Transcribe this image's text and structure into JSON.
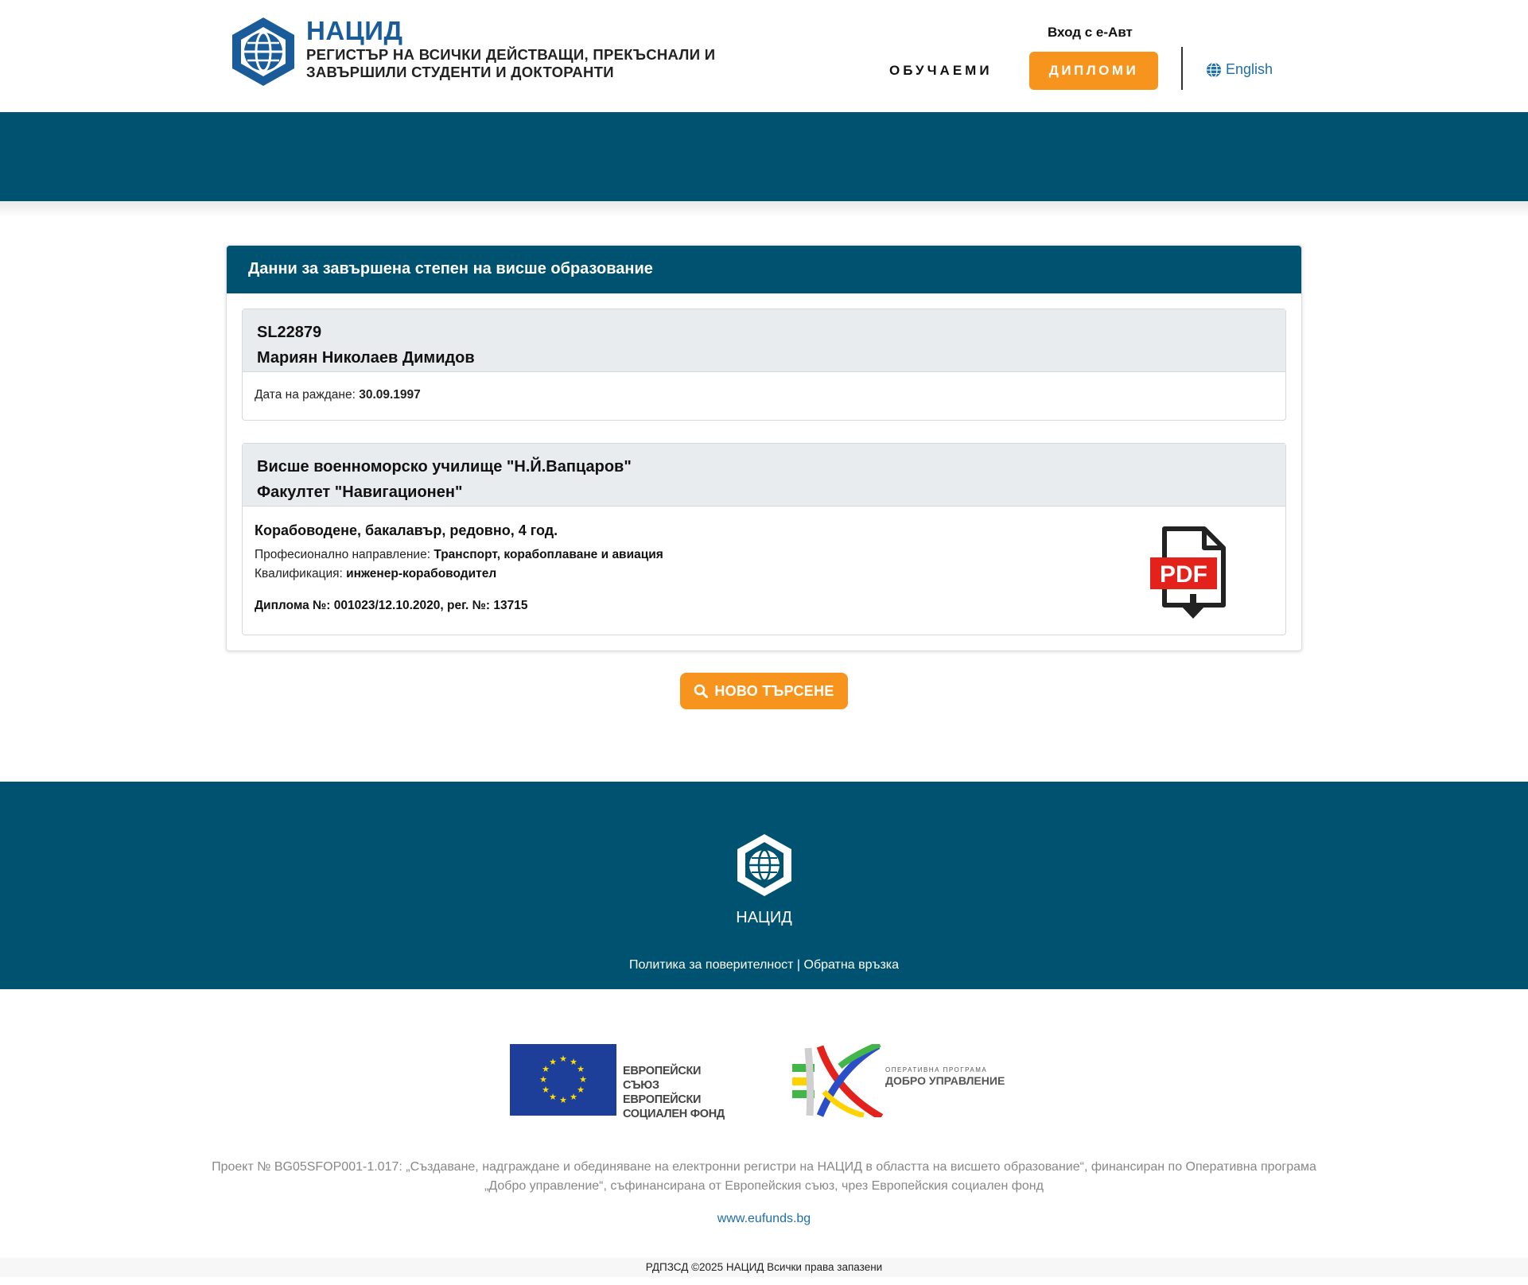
{
  "header": {
    "brand_name": "НАЦИД",
    "brand_subtitle": "РЕГИСТЪР НА ВСИЧКИ ДЕЙСТВАЩИ, ПРЕКЪСНАЛИ И ЗАВЪРШИЛИ СТУДЕНТИ И ДОКТОРАНТИ",
    "eauth_label": "Вход с е-Авт",
    "nav_students": "ОБУЧАЕМИ",
    "nav_diplomas": "ДИПЛОМИ",
    "language_label": "English"
  },
  "card": {
    "title": "Данни за завършена степен на висше образование",
    "person": {
      "id": "SL22879",
      "name": "Мариян Николаев Димидов",
      "birth_label": "Дата на раждане:",
      "birth_date": "30.09.1997"
    },
    "education": {
      "institution": "Висше военноморско училище \"Н.Й.Вапцаров\"",
      "faculty": "Факултет \"Навигационен\"",
      "specialty": "Корабоводене, бакалавър, редовно, 4 год.",
      "field_label": "Професионално направление:",
      "field_value": "Транспорт, корабоплаване и авиация",
      "qualification_label": "Квалификация:",
      "qualification_value": "инженер-корабоводител",
      "diploma": "Диплома №: 001023/12.10.2020, рег. №: 13715",
      "pdf_label": "PDF"
    }
  },
  "new_search_label": "НОВО ТЪРСЕНЕ",
  "footer": {
    "name": "НАЦИД",
    "privacy_link": "Политика за поверителност",
    "separator": "|",
    "feedback_link": "Обратна връзка"
  },
  "sponsors": {
    "eu_text": [
      "ЕВРОПЕЙСКИ СЪЮЗ",
      "ЕВРОПЕЙСКИ",
      "СОЦИАЛЕН ФОНД"
    ],
    "og_small": "ОПЕРАТИВНА ПРОГРАМА",
    "og_big": "ДОБРО УПРАВЛЕНИЕ"
  },
  "project_text": "Проект № BG05SFOP001-1.017: „Създаване, надграждане и обединяване на електронни регистри на НАЦИД в областта на висшето образование“, финансиран по Оперативна програма „Добро управление“, съфинансирана от Европейския съюз, чрез Европейския социален фонд",
  "eufunds_link": "www.eufunds.bg",
  "copyright": "РДПЗСД ©2025 НАЦИД Всички права запазени",
  "colors": {
    "primary": "#005370",
    "accent": "#f7941d",
    "brand": "#1a5c9a",
    "link": "#1d6fa8"
  }
}
